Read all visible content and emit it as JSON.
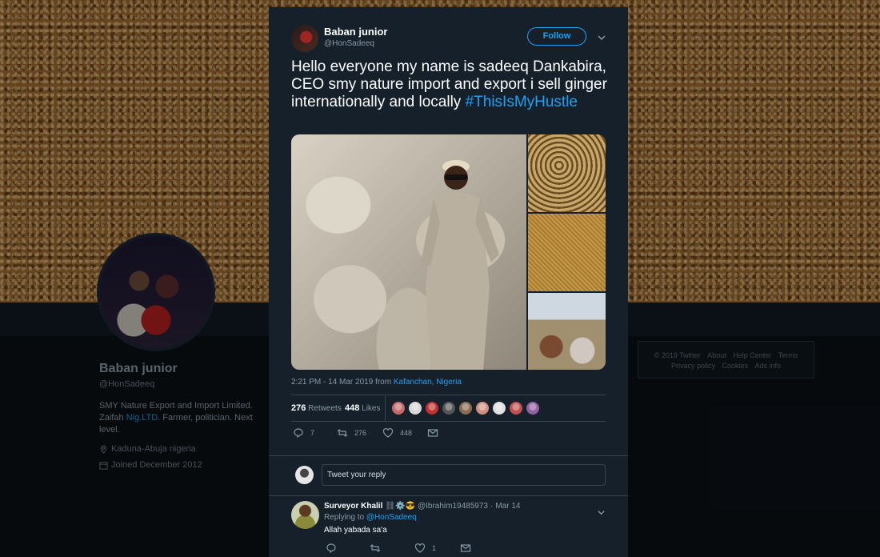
{
  "profile": {
    "name": "Baban junior",
    "handle": "@HonSadeeq",
    "bio_text": "SMY Nature Export and Import Limited. Zaifah ",
    "bio_link": "Nig.LTD",
    "bio_tail": ". Farmer, politician. Next level.",
    "location": "Kaduna-Abuja nigeria",
    "joined": "Joined December 2012"
  },
  "footer": {
    "links_row1": [
      "© 2019 Twitter",
      "About",
      "Help Center",
      "Terms"
    ],
    "links_row2": [
      "Privacy policy",
      "Cookies",
      "Ads info"
    ]
  },
  "tweet": {
    "author_name": "Baban junior",
    "author_handle": "@HonSadeeq",
    "follow_label": "Follow",
    "text": "Hello everyone my name is sadeeq Dankabira, CEO smy nature import and export i sell ginger internationally and locally ",
    "hashtag": "#ThisIsMyHustle",
    "time": "2:21 PM - 14 Mar 2019 from ",
    "location": "Kafanchan, Nigeria",
    "retweets_count": "276",
    "retweets_label": "Retweets",
    "likes_count": "448",
    "likes_label": "Likes",
    "liker_colors": [
      "#c46a6a",
      "#d8d8d8",
      "#c03030",
      "#555555",
      "#8a6a50",
      "#d09080",
      "#e0e0e0",
      "#c05050",
      "#9060a0"
    ],
    "actions": {
      "reply_count": "7",
      "retweet_count": "276",
      "like_count": "448"
    }
  },
  "reply_box": {
    "placeholder": "Tweet your reply"
  },
  "reply": {
    "name": "Surveyor Khalil",
    "emoji": "⛓⚙️😎",
    "handle": "@Ibrahim19485973",
    "separator": "·",
    "date": "Mar 14",
    "replying_prefix": "Replying to ",
    "replying_to": "@HonSadeeq",
    "text": "Allah yabada sa'a",
    "like_count": "1"
  },
  "colors": {
    "accent": "#1da1f2",
    "modal_bg": "#15202b",
    "muted": "#8899a6"
  }
}
